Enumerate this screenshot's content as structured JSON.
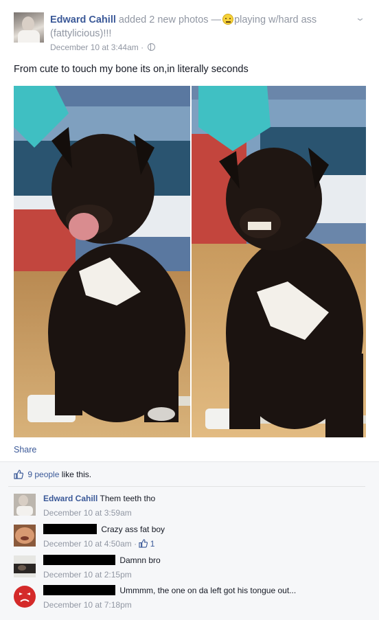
{
  "post": {
    "author": "Edward Cahill",
    "action": "added 2 new photos —",
    "feeling": "playing w/hard ass (fattylicious)!!!",
    "feeling_icon": "smiley-icon",
    "timestamp": "December 10 at 3:44am",
    "separator": "·",
    "privacy_icon": "globe-icon",
    "menu_icon": "chevron-down-icon",
    "status": "From cute to touch my bone its on,in literally seconds",
    "share_label": "Share"
  },
  "likes": {
    "count_text": "9 people",
    "suffix": "like this."
  },
  "comments": [
    {
      "name": "Edward Cahill",
      "text": "Them teeth tho",
      "time": "December 10 at 3:59am"
    },
    {
      "name": "",
      "text": "Crazy ass fat boy",
      "time": "December 10 at 4:50am",
      "like_count": "1"
    },
    {
      "name": "",
      "text": "Damnn bro",
      "time": "December 10 at 2:15pm"
    },
    {
      "name": "",
      "text": "Ummmm, the one on da left got his tongue out...",
      "time": "December 10 at 7:18pm"
    }
  ],
  "colors": {
    "link": "#3b5998",
    "meta": "#9197a3",
    "text": "#141823",
    "feedback_bg": "#f6f7f9"
  }
}
